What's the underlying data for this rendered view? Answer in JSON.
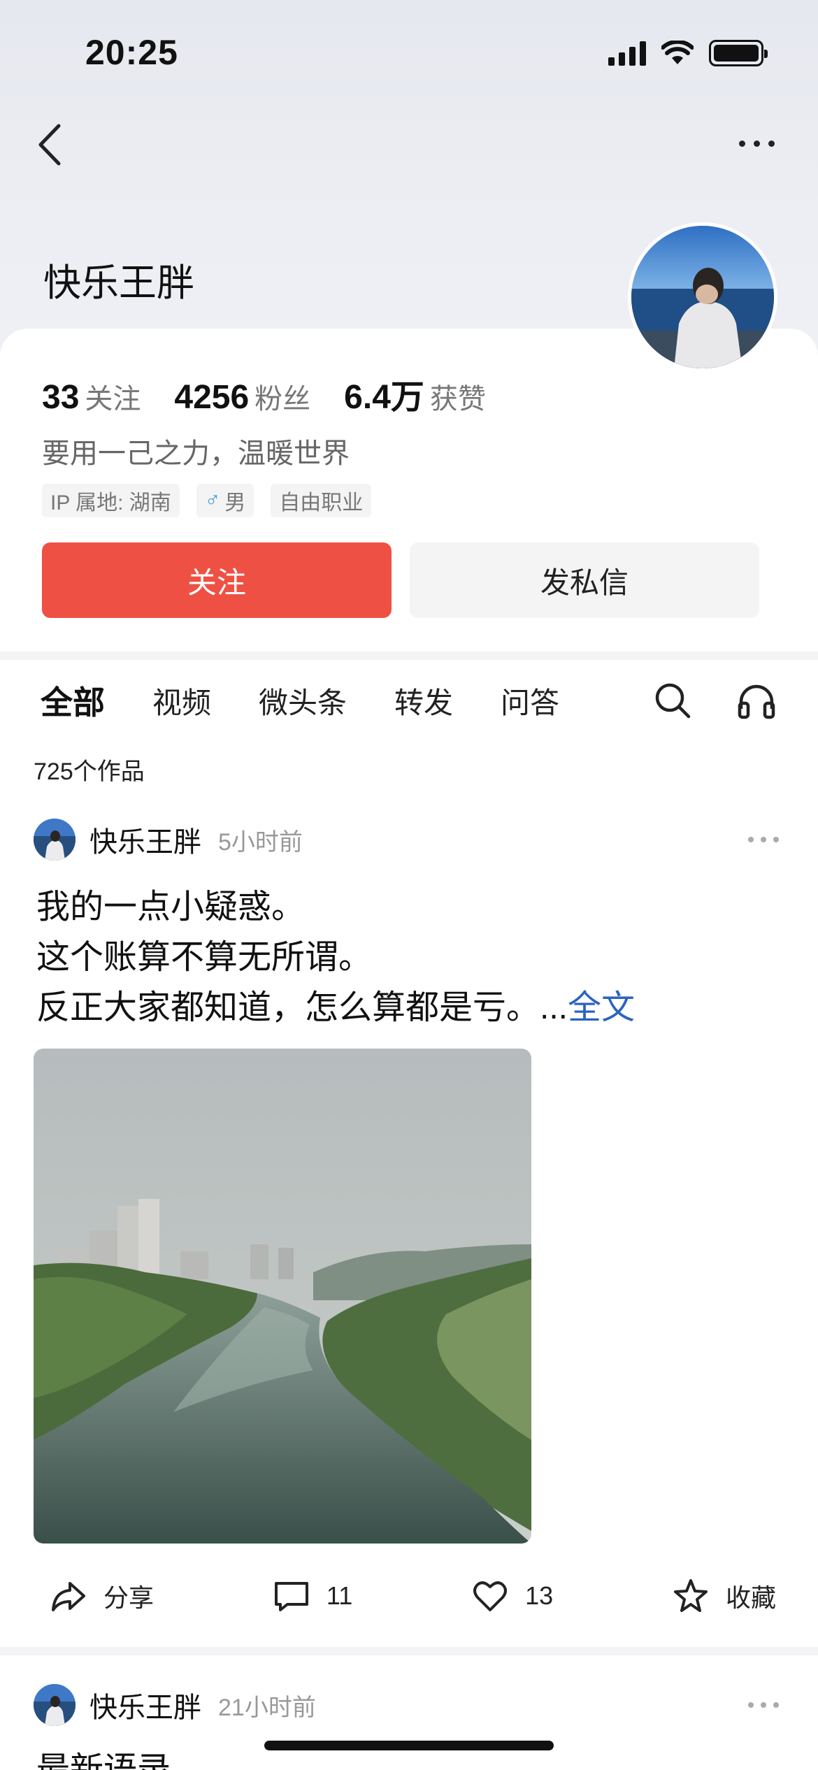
{
  "status_bar": {
    "time": "20:25"
  },
  "profile": {
    "name": "快乐王胖",
    "stats": [
      {
        "num": "33",
        "label": "关注"
      },
      {
        "num": "4256",
        "label": "粉丝"
      },
      {
        "num": "6.4万",
        "label": "获赞"
      }
    ],
    "bio": "要用一己之力，温暖世界",
    "tags": [
      "IP 属地: 湖南",
      "男",
      "自由职业"
    ],
    "follow_label": "关注",
    "message_label": "发私信"
  },
  "tabs": [
    "全部",
    "视频",
    "微头条",
    "转发",
    "问答"
  ],
  "works_count": "725个作品",
  "posts": [
    {
      "author": "快乐王胖",
      "time": "5小时前",
      "lines": [
        "我的一点小疑惑。",
        "这个账算不算无所谓。",
        "反正大家都知道，怎么算都是亏。..."
      ],
      "more_link": "全文",
      "share_label": "分享",
      "comments": "11",
      "likes": "13",
      "collect_label": "收藏"
    },
    {
      "author": "快乐王胖",
      "time": "21小时前",
      "text": "最新语录"
    }
  ],
  "colors": {
    "follow_button": "#ee5144",
    "link": "#2b63c0"
  }
}
